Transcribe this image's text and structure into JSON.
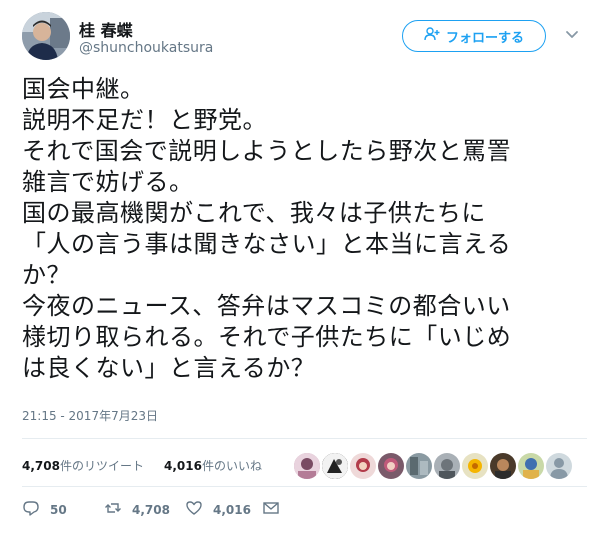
{
  "user": {
    "display_name": "桂 春蝶",
    "handle": "@shunchoukatsura",
    "follow_label": "フォローする"
  },
  "tweet": {
    "lines": [
      "国会中継。",
      "説明不足だ！と野党。",
      "それで国会で説明しようとしたら野次と罵詈",
      "雑言で妨げる。",
      "国の最高機関がこれで、我々は子供たちに",
      "「人の言う事は聞きなさい」と本当に言える",
      "か？",
      "今夜のニュース、答弁はマスコミの都合いい",
      "様切り取られる。それで子供たちに「いじめ",
      "は良くない」と言えるか？"
    ],
    "timestamp": "21:15 - 2017年7月23日"
  },
  "stats": {
    "retweets_count": "4,708",
    "retweets_label": "件のリツイート",
    "likes_count": "4,016",
    "likes_label": "件のいいね"
  },
  "actions": {
    "replies": "50",
    "retweets": "4,708",
    "likes": "4,016"
  },
  "icons": [
    "person-add-icon",
    "chevron-down-icon",
    "reply-icon",
    "retweet-icon",
    "heart-icon",
    "mail-icon"
  ],
  "colors": {
    "accent": "#1da1f2",
    "text": "#14171a",
    "muted": "#657786",
    "border": "#e6ecf0"
  }
}
